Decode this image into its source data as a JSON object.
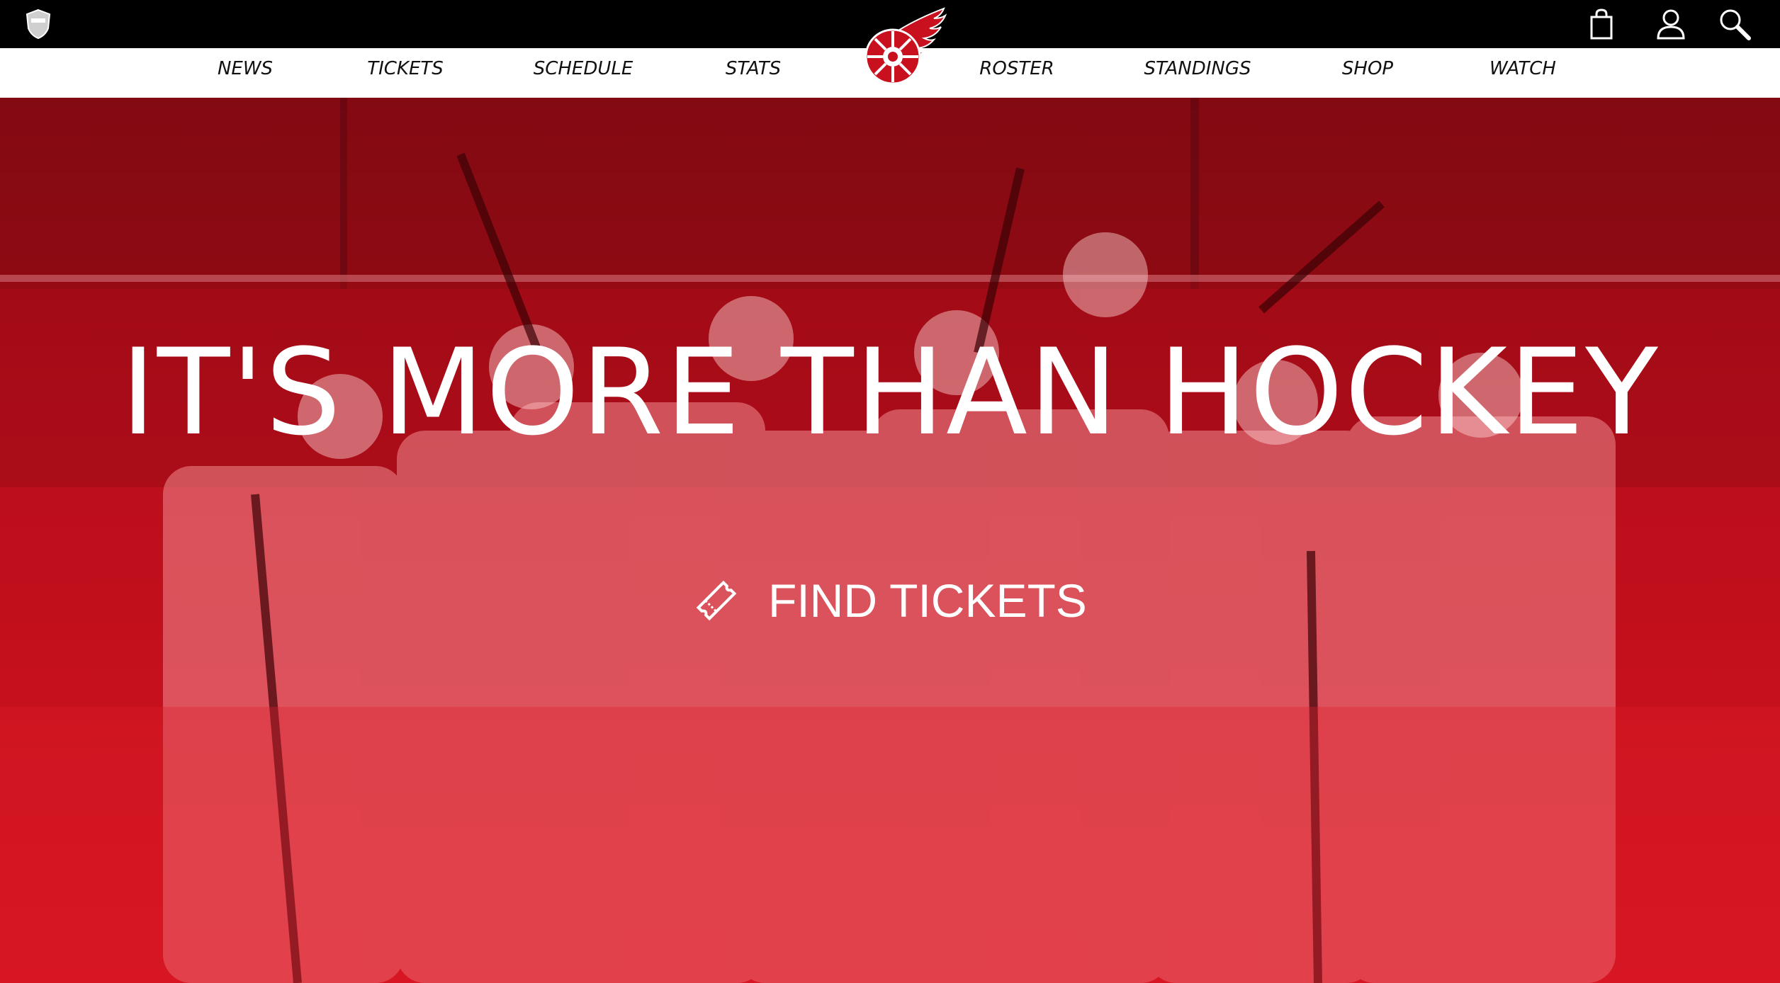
{
  "topbar": {
    "league_logo_icon": "nhl-shield-icon",
    "icons": [
      "shopping-bag-icon",
      "account-icon",
      "search-icon"
    ]
  },
  "nav": {
    "items": [
      {
        "label": "NEWS"
      },
      {
        "label": "TICKETS"
      },
      {
        "label": "SCHEDULE"
      },
      {
        "label": "STATS"
      },
      {
        "label": "ROSTER"
      },
      {
        "label": "STANDINGS"
      },
      {
        "label": "SHOP"
      },
      {
        "label": "WATCH"
      }
    ],
    "logo_icon": "red-wings-winged-wheel-logo"
  },
  "hero": {
    "title": "IT'S MORE THAN HOCKEY",
    "cta_label": "FIND TICKETS",
    "cta_icon": "ticket-icon"
  },
  "colors": {
    "topbar": "#000000",
    "navbar": "#ffffff",
    "brand_red": "#c8101e",
    "hero_text": "#ffffff"
  }
}
